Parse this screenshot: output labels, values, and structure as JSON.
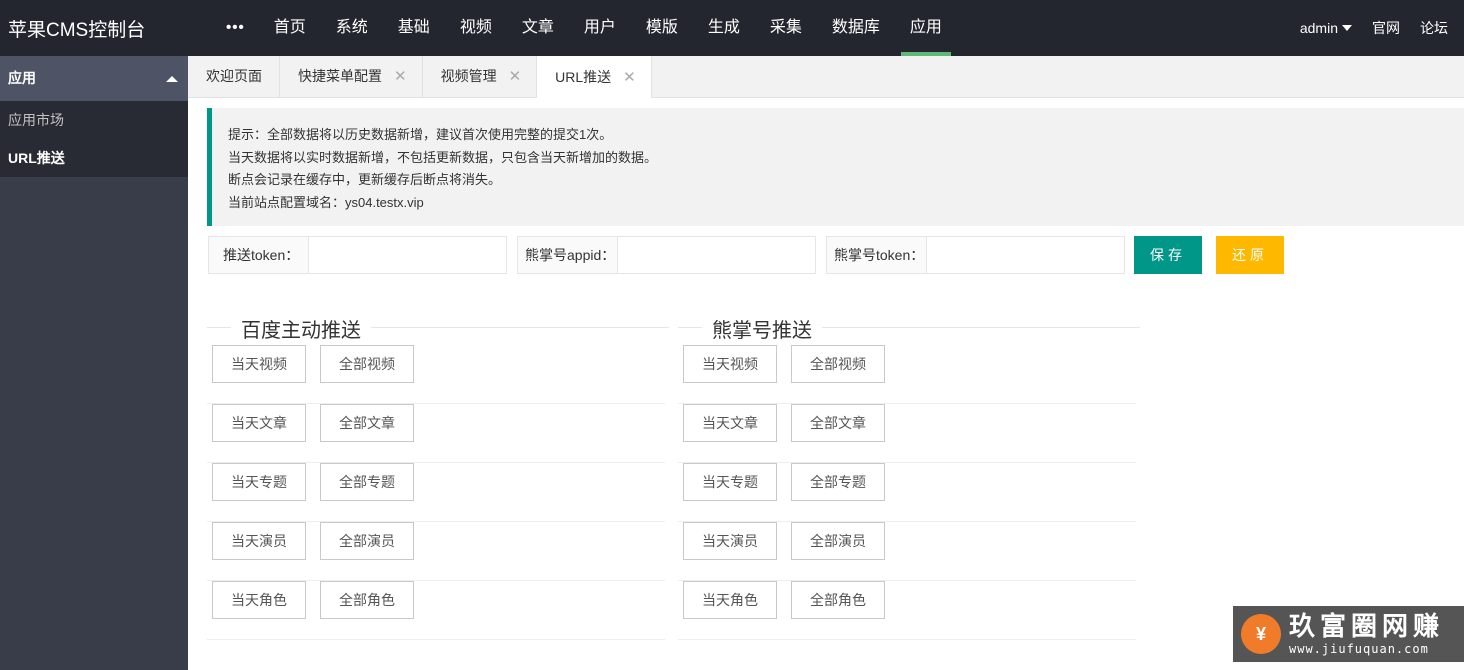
{
  "app": {
    "title": "苹果CMS控制台"
  },
  "topnav": {
    "more": "•••",
    "items": [
      "首页",
      "系统",
      "基础",
      "视频",
      "文章",
      "用户",
      "模版",
      "生成",
      "采集",
      "数据库",
      "应用"
    ],
    "active": "应用"
  },
  "topright": {
    "user": "admin",
    "official": "官网",
    "forum": "论坛"
  },
  "sidebar": {
    "group": "应用",
    "items": [
      "应用市场",
      "URL推送"
    ],
    "active": "URL推送"
  },
  "tabs": [
    "欢迎页面",
    "快捷菜单配置",
    "视频管理",
    "URL推送"
  ],
  "active_tab": "URL推送",
  "notice": [
    "提示：全部数据将以历史数据新增，建议首次使用完整的提交1次。",
    "当天数据将以实时数据新增，不包括更新数据，只包含当天新增加的数据。",
    "断点会记录在缓存中，更新缓存后断点将消失。",
    "当前站点配置域名：ys04.testx.vip"
  ],
  "form": {
    "push_token_label": "推送token：",
    "push_token_value": "",
    "xzh_appid_label": "熊掌号appid：",
    "xzh_appid_value": "",
    "xzh_token_label": "熊掌号token：",
    "xzh_token_value": "",
    "save": "保存",
    "reset": "还原"
  },
  "sections": [
    {
      "title": "百度主动推送",
      "rows": [
        [
          "当天视频",
          "全部视频"
        ],
        [
          "当天文章",
          "全部文章"
        ],
        [
          "当天专题",
          "全部专题"
        ],
        [
          "当天演员",
          "全部演员"
        ],
        [
          "当天角色",
          "全部角色"
        ]
      ]
    },
    {
      "title": "熊掌号推送",
      "rows": [
        [
          "当天视频",
          "全部视频"
        ],
        [
          "当天文章",
          "全部文章"
        ],
        [
          "当天专题",
          "全部专题"
        ],
        [
          "当天演员",
          "全部演员"
        ],
        [
          "当天角色",
          "全部角色"
        ]
      ]
    }
  ],
  "watermark": {
    "title": "玖富圈网赚",
    "url": "www.jiufuquan.com",
    "logo_char": "¥"
  },
  "colors": {
    "header": "#23262e",
    "sidebar": "#393d49",
    "accent": "#009688",
    "active_nav": "#5fb878",
    "warn": "#ffb800"
  }
}
